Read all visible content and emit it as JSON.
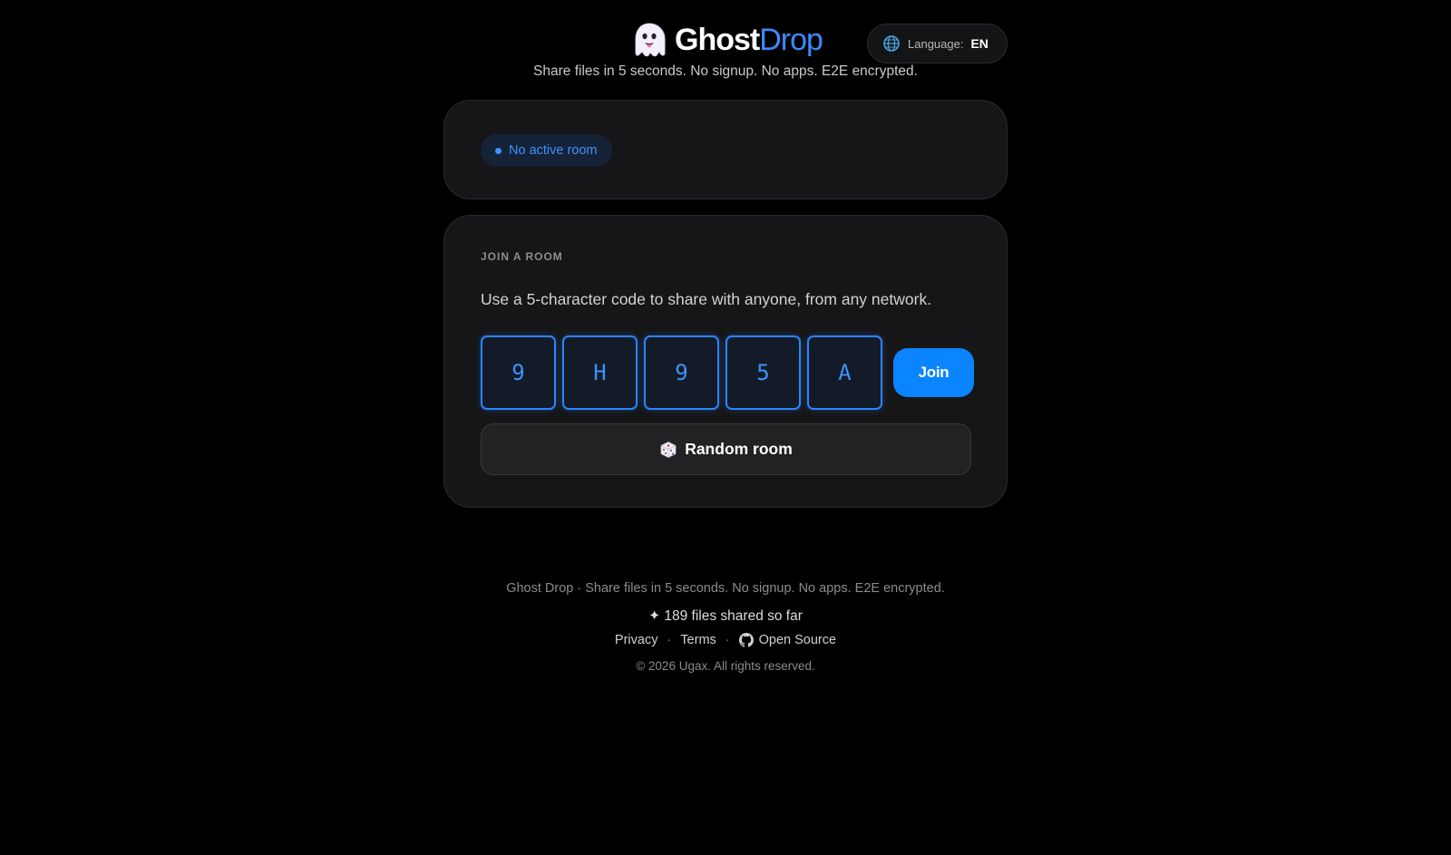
{
  "header": {
    "logo_icon": "ghost-icon",
    "brand_part1": "Ghost",
    "brand_part2": "Drop",
    "tagline": "Share files in 5 seconds. No signup. No apps. E2E encrypted."
  },
  "language": {
    "icon": "globe-icon",
    "label": "Language:",
    "value": "EN"
  },
  "status": {
    "text": "No active room",
    "color": "#3d93ff"
  },
  "join": {
    "heading": "JOIN A ROOM",
    "description": "Use a 5-character code to share with anyone, from any network.",
    "code_chars": [
      "9",
      "H",
      "9",
      "5",
      "A"
    ],
    "join_label": "Join",
    "random_icon": "dice-icon",
    "random_label": "Random room"
  },
  "footer": {
    "line1": "Ghost Drop · Share files in 5 seconds. No signup. No apps. E2E encrypted.",
    "count_text": "✦ 189 files shared so far",
    "links": {
      "privacy": "Privacy",
      "terms": "Terms",
      "open_source": "Open Source",
      "separator": "·"
    },
    "copyright": "© 2026 Ugax. All rights reserved."
  },
  "colors": {
    "accent": "#0a84ff",
    "background": "#000000",
    "card": "#161618"
  }
}
